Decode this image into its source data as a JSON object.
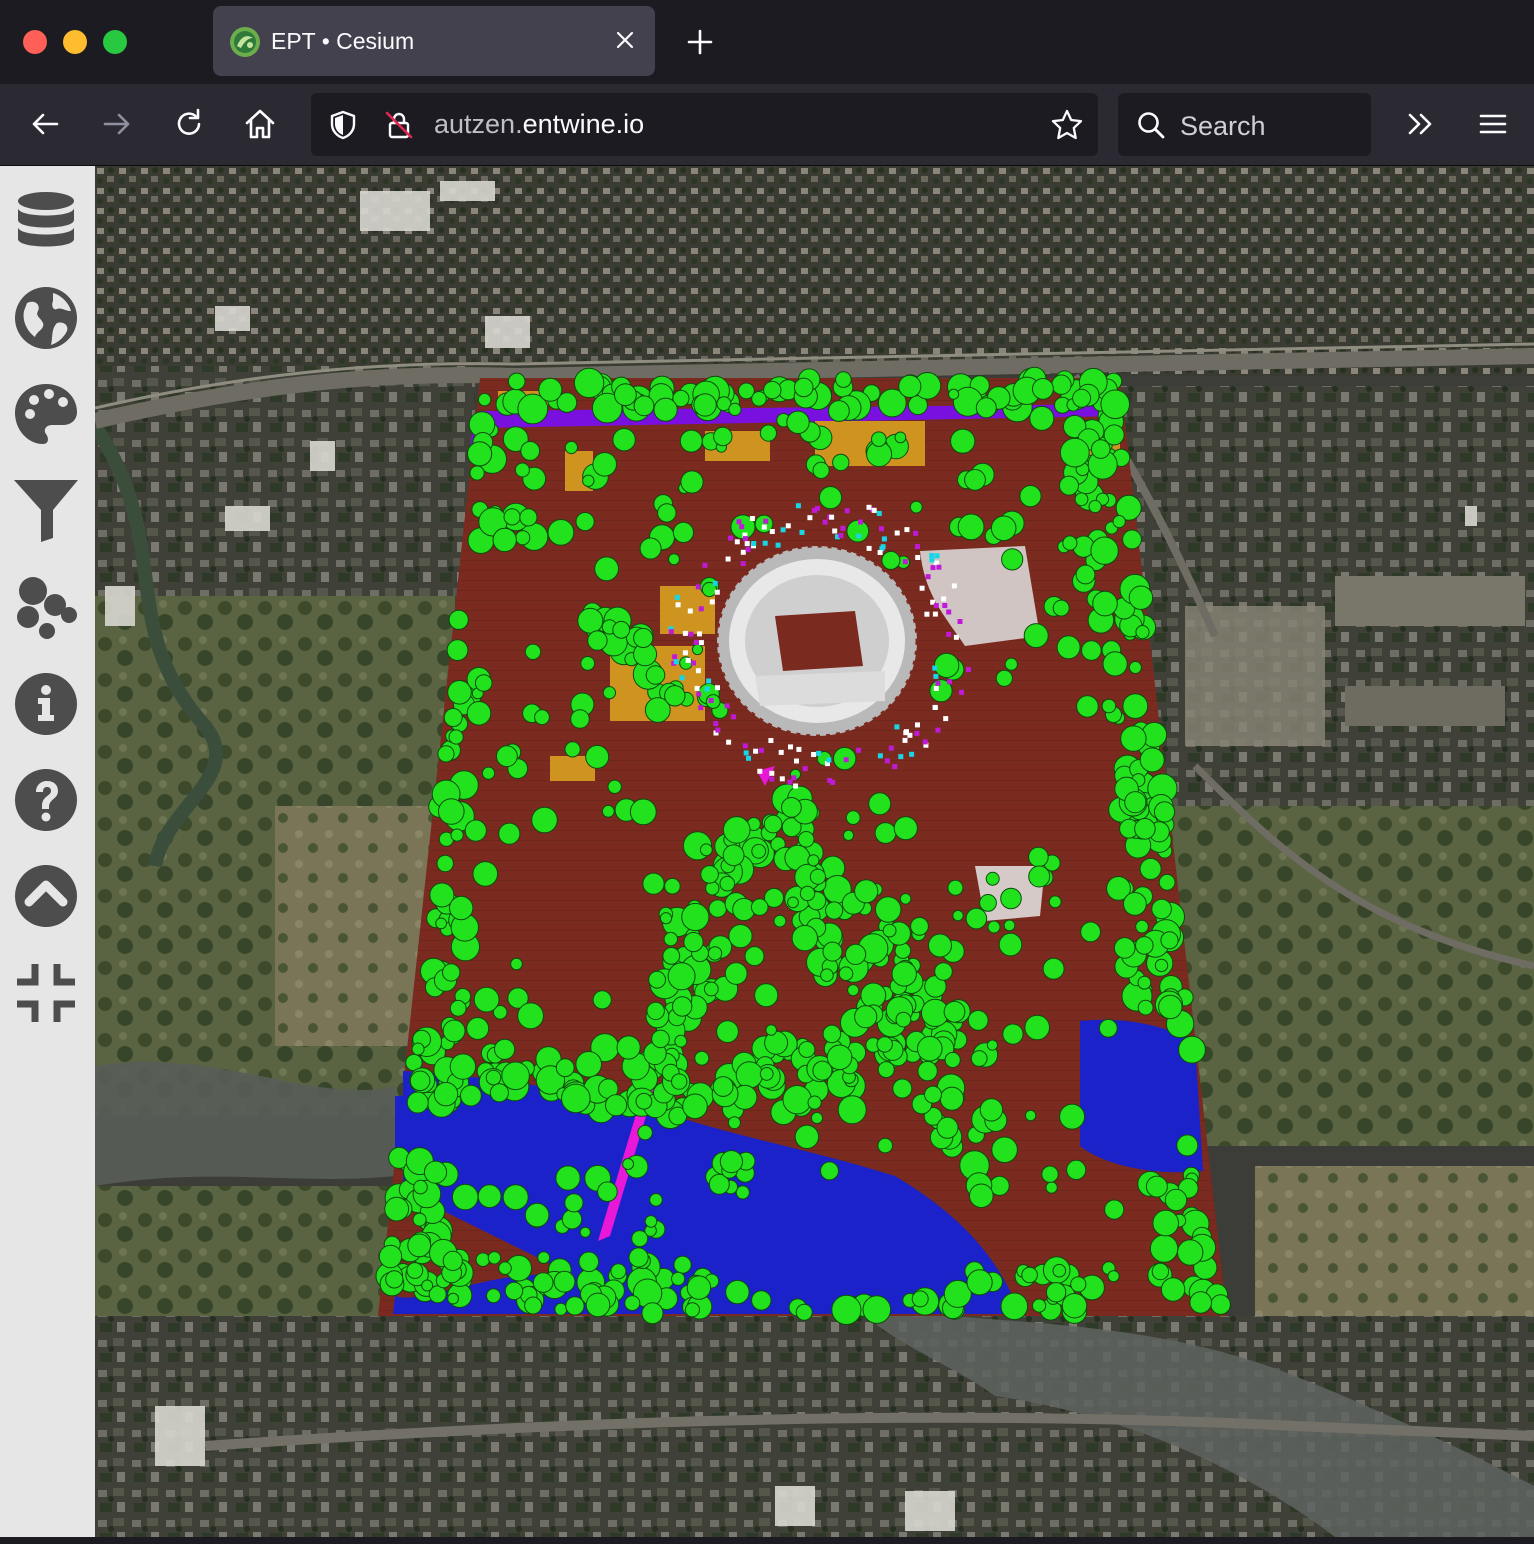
{
  "window": {
    "traffic_lights": {
      "close_color": "#fe5f57",
      "minimize_color": "#febc2e",
      "zoom_color": "#28c840"
    }
  },
  "tab": {
    "title": "EPT • Cesium",
    "favicon": "cesium-logo-icon",
    "close_icon": "close-icon"
  },
  "toolbar": {
    "back_icon": "arrow-left-icon",
    "forward_icon": "arrow-right-icon",
    "reload_icon": "reload-icon",
    "home_icon": "home-icon",
    "overflow_icon": "chevron-double-right-icon",
    "menu_icon": "hamburger-menu-icon"
  },
  "urlbar": {
    "url_prefix": "autzen.",
    "url_domain": "entwine.io",
    "tracking_icon": "shield-icon",
    "insecure_icon": "lock-crossed-icon",
    "bookmark_icon": "star-icon"
  },
  "search": {
    "placeholder": "Search"
  },
  "sidebar": {
    "items": [
      {
        "id": "resources",
        "icon": "database-icon"
      },
      {
        "id": "imagery",
        "icon": "globe-icon"
      },
      {
        "id": "coloring",
        "icon": "palette-icon"
      },
      {
        "id": "filter",
        "icon": "filter-icon"
      },
      {
        "id": "points",
        "icon": "points-icon"
      },
      {
        "id": "info",
        "icon": "info-icon"
      },
      {
        "id": "help",
        "icon": "help-icon"
      },
      {
        "id": "collapse",
        "icon": "chevron-up-circle-icon"
      },
      {
        "id": "exit-fullscreen",
        "icon": "compress-icon"
      }
    ],
    "icon_color": "#4d4d4d",
    "background": "#e6e6e6"
  },
  "viewer": {
    "scene": "point-cloud-over-satellite-imagery",
    "colors": {
      "ground": "#7a2a1f",
      "vegetation": "#22e21e",
      "water": "#1c22c9",
      "building": "#cf9420",
      "road": "#7a10e0",
      "bridge": "#e818d8",
      "stadium": "#d9d9d9",
      "imagery_dark": "#3c3d38",
      "imagery_green": "#55603f"
    }
  }
}
